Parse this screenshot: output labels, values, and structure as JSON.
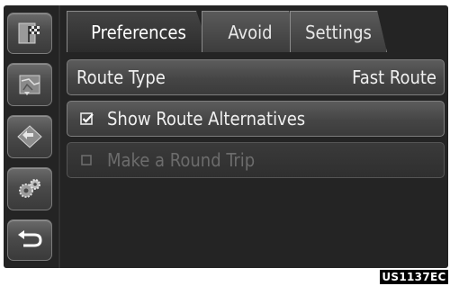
{
  "tabs": [
    {
      "label": "Preferences",
      "active": true
    },
    {
      "label": "Avoid",
      "active": false
    },
    {
      "label": "Settings",
      "active": false
    }
  ],
  "rows": {
    "route_type": {
      "label": "Route Type",
      "value": "Fast Route"
    },
    "show_alternatives": {
      "label": "Show Route Alternatives",
      "checked": true
    },
    "round_trip": {
      "label": "Make a Round Trip",
      "checked": false,
      "enabled": false
    }
  },
  "rail_icons": [
    "destination-flag-icon",
    "map-icon",
    "route-arrow-icon",
    "settings-gears-icon",
    "back-icon"
  ],
  "footer_code": "US1137EC",
  "colors": {
    "screen_bg": "#242424",
    "button_face": "#4a4a4a",
    "text": "#f0f0f0",
    "disabled_text": "#6c6c6c"
  }
}
